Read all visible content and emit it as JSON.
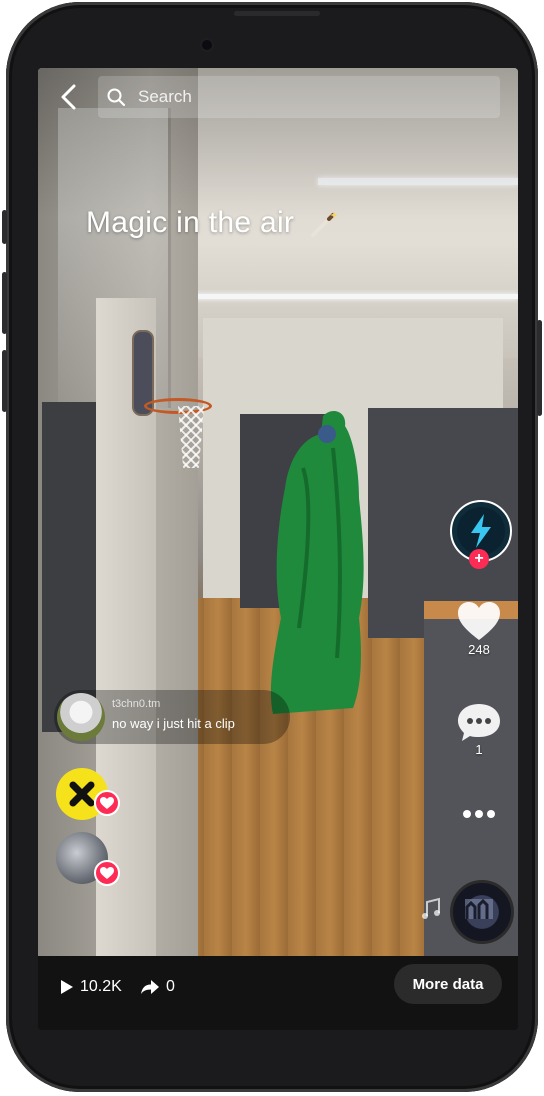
{
  "topbar": {
    "search_placeholder": "Search"
  },
  "video": {
    "caption": "Magic in the air"
  },
  "actions": {
    "likes": "248",
    "comments": "1"
  },
  "comment": {
    "username": "t3chn0.tm",
    "text": "no way i just hit a clip"
  },
  "bottombar": {
    "views": "10.2K",
    "shares": "0",
    "more_label": "More data"
  },
  "colors": {
    "like_red": "#fe2c55",
    "screen_bg": "#121212",
    "pill_bg": "#2b2b2b"
  }
}
